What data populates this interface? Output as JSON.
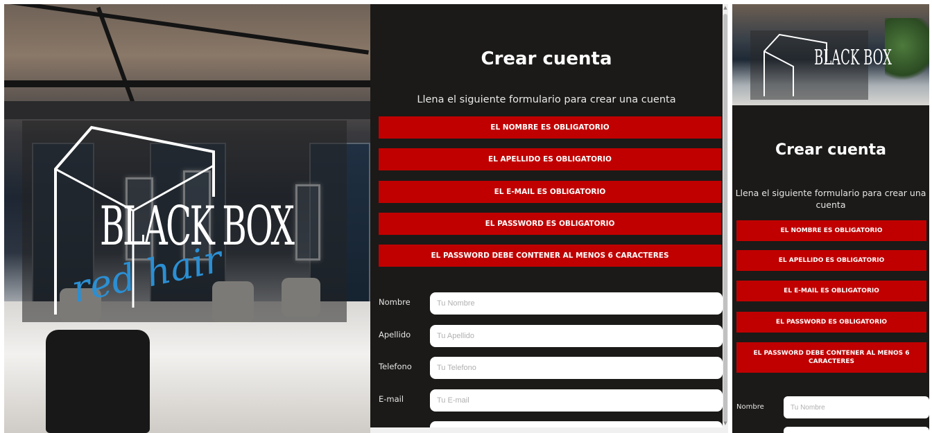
{
  "desktop": {
    "logo": {
      "wordmark": "BLACK BOX",
      "script": "red hair"
    },
    "form": {
      "title": "Crear cuenta",
      "subtitle": "Llena el siguiente formulario para crear una cuenta",
      "alerts": [
        "EL NOMBRE ES OBLIGATORIO",
        "EL APELLIDO ES OBLIGATORIO",
        "EL E-MAIL ES OBLIGATORIO",
        "EL PASSWORD ES OBLIGATORIO",
        "EL PASSWORD DEBE CONTENER AL MENOS 6 CARACTERES"
      ],
      "fields": [
        {
          "label": "Nombre",
          "placeholder": "Tu Nombre"
        },
        {
          "label": "Apellido",
          "placeholder": "Tu Apellido"
        },
        {
          "label": "Telefono",
          "placeholder": "Tu Telefono"
        },
        {
          "label": "E-mail",
          "placeholder": "Tu E-mail"
        }
      ]
    }
  },
  "mobile": {
    "logo": {
      "wordmark": "BLACK BOX"
    },
    "form": {
      "title": "Crear cuenta",
      "subtitle": "Llena el siguiente formulario para crear una cuenta",
      "alerts": [
        "EL NOMBRE ES OBLIGATORIO",
        "EL APELLIDO ES OBLIGATORIO",
        "EL E-MAIL ES OBLIGATORIO",
        "EL PASSWORD ES OBLIGATORIO",
        "EL PASSWORD DEBE CONTENER AL MENOS 6 CARACTERES"
      ],
      "fields": [
        {
          "label": "Nombre",
          "placeholder": "Tu Nombre"
        }
      ]
    }
  },
  "colors": {
    "panel_bg": "#1b1a18",
    "alert_bg": "#c00000",
    "script_blue": "#2b8fd3"
  }
}
